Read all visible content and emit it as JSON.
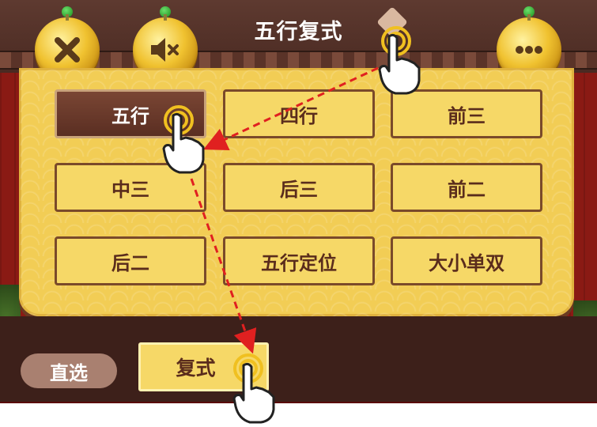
{
  "header": {
    "title": "五行复式"
  },
  "icons": {
    "close": "close-icon",
    "mute": "speaker-muted-icon",
    "more": "more-dots-icon",
    "hand": "pointing-hand-icon"
  },
  "grid": {
    "items": [
      {
        "label": "五行",
        "active": true
      },
      {
        "label": "四行",
        "active": false
      },
      {
        "label": "前三",
        "active": false
      },
      {
        "label": "中三",
        "active": false
      },
      {
        "label": "后三",
        "active": false
      },
      {
        "label": "前二",
        "active": false
      },
      {
        "label": "后二",
        "active": false
      },
      {
        "label": "五行定位",
        "active": false
      },
      {
        "label": "大小单双",
        "active": false
      }
    ]
  },
  "bottom": {
    "direct_label": "直选",
    "compound_label": "复式"
  },
  "colors": {
    "panel": "#f2cd55",
    "button_border": "#7a4a2a",
    "active_button": "#5a2e22",
    "text_brown": "#5a2c1c",
    "arrow_red": "#e02020"
  }
}
